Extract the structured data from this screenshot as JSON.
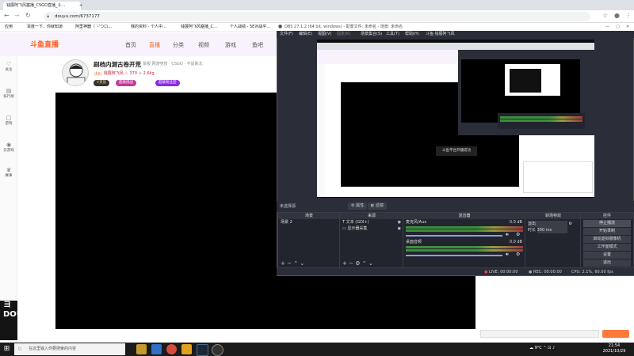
{
  "browser": {
    "tabs": [
      {
        "label": "钱展阿飞风塞播_CSGO直播_斗…",
        "active": true
      },
      {
        "label": "",
        "active": false
      }
    ],
    "url": "douyu.com/6737177",
    "bookmarks": [
      "应用",
      "百度一下，你就知道",
      "阿里神器（ '-'つロ…",
      "我的资料 - 个人中…",
      "钱展阿飞风塞播_C…",
      "个人战绩 - 5E对战平…"
    ],
    "new_tab": "+"
  },
  "douyu": {
    "logo": "斗鱼直播",
    "nav": [
      "首页",
      "直播",
      "分类",
      "视频",
      "游戏",
      "鱼吧"
    ],
    "sidebar": [
      "关注",
      "排行榜",
      "游戏",
      "云游戏",
      "赛事"
    ],
    "room_title": "剧档内测古卷开荒",
    "room_meta": "举报  网游竞技 · CSGO · 不是陈北",
    "streamer_name": "钱展阿飞风",
    "heat": "370",
    "followers": "2.6kg",
    "btn_vip": "V贵族",
    "btn_gift": "超级挑战",
    "btn_join": "超级粉丝团"
  },
  "obs": {
    "title": "OBS 27.1.2 (64 bit, windows) - 配置文件: 未命名 - 场景: 未命名",
    "menu": [
      "文件(F)",
      "编辑(E)",
      "视图(V)",
      "固定(K)",
      "场景集合(S)",
      "工具(T)",
      "帮助(H)",
      "斗鱼·钱展阿飞风"
    ],
    "preview_toast": "斗鱼平台开播成功",
    "no_source_label": "未选择源",
    "toolbar_buttons": [
      "属性",
      "滤镜"
    ],
    "docks": {
      "scenes": {
        "title": "场景",
        "items": [
          "场景 2"
        ]
      },
      "sources": {
        "title": "来源",
        "items": [
          "文本 (GDI+)",
          "显示器采集"
        ]
      },
      "mixer": {
        "title": "混音器",
        "channels": [
          {
            "name": "麦克风/Aux",
            "level": "0.0 dB"
          },
          {
            "name": "桌面音频",
            "level": "0.0 dB"
          }
        ]
      },
      "transitions": {
        "title": "转场特效",
        "type": "淡出",
        "duration_label": "时长",
        "duration": "300 ms"
      },
      "controls": {
        "title": "控件",
        "buttons": [
          "停止播流",
          "开始录制",
          "启动虚拟摄像机",
          "工作室模式",
          "设置",
          "退出"
        ]
      }
    },
    "status": {
      "live": "LIVE: 00:00:00",
      "rec": "REC: 00:00:00",
      "cpu": "CPU: 2.1%, 60.00 fps"
    }
  },
  "taskbar": {
    "search_placeholder": "在这里输入你要搜索的内容",
    "tray": "9°C",
    "time": "21:54",
    "date": "2021/10/29"
  },
  "colors": {
    "douyu_orange": "#ff5d23",
    "douyu_purple": "#8a2be2",
    "obs_bg": "#2b2e38"
  }
}
